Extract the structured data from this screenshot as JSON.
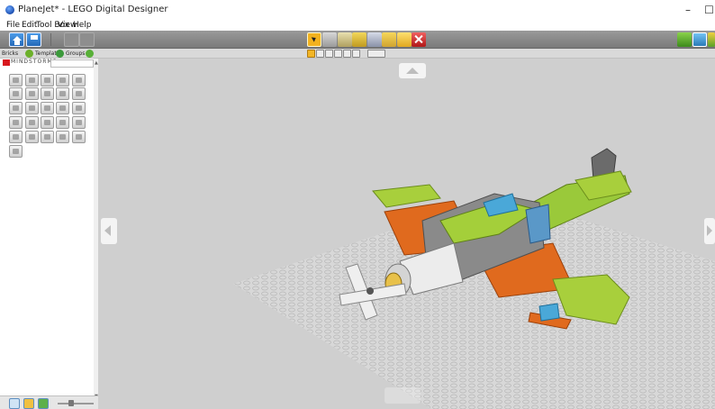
{
  "window": {
    "title": "PlaneJet* - LEGO Digital Designer",
    "minimize_label": "–",
    "maximize_label": "☐"
  },
  "menu": {
    "items": [
      "File",
      "Edit",
      "Tool Box",
      "View",
      "Help"
    ]
  },
  "toolbar": {
    "left_icons": [
      "home-icon",
      "save-icon",
      "undo-icon",
      "redo-icon"
    ],
    "tools": [
      "select-tool-icon",
      "clone-tool-icon",
      "hinge-tool-icon",
      "hinge-align-tool-icon",
      "flex-tool-icon",
      "paint-tool-icon",
      "hide-tool-icon",
      "delete-tool-icon"
    ],
    "right_icons": [
      "build-mode-icon",
      "view-mode-icon"
    ]
  },
  "subtoolbar": {
    "tabs": [
      {
        "label": "Bricks"
      },
      {
        "label": "Templates"
      },
      {
        "label": "Groups"
      }
    ]
  },
  "sidebar": {
    "palette_title": "MINDSTORMS",
    "search": {
      "value": "",
      "placeholder": ""
    },
    "brick_count": 21
  },
  "colors": {
    "toolbar": "#8a8a8a",
    "viewport": "#cfcfcf",
    "accent_orange": "#f3b626",
    "lime": "#9ac93a",
    "orange_brick": "#e06a1e"
  }
}
